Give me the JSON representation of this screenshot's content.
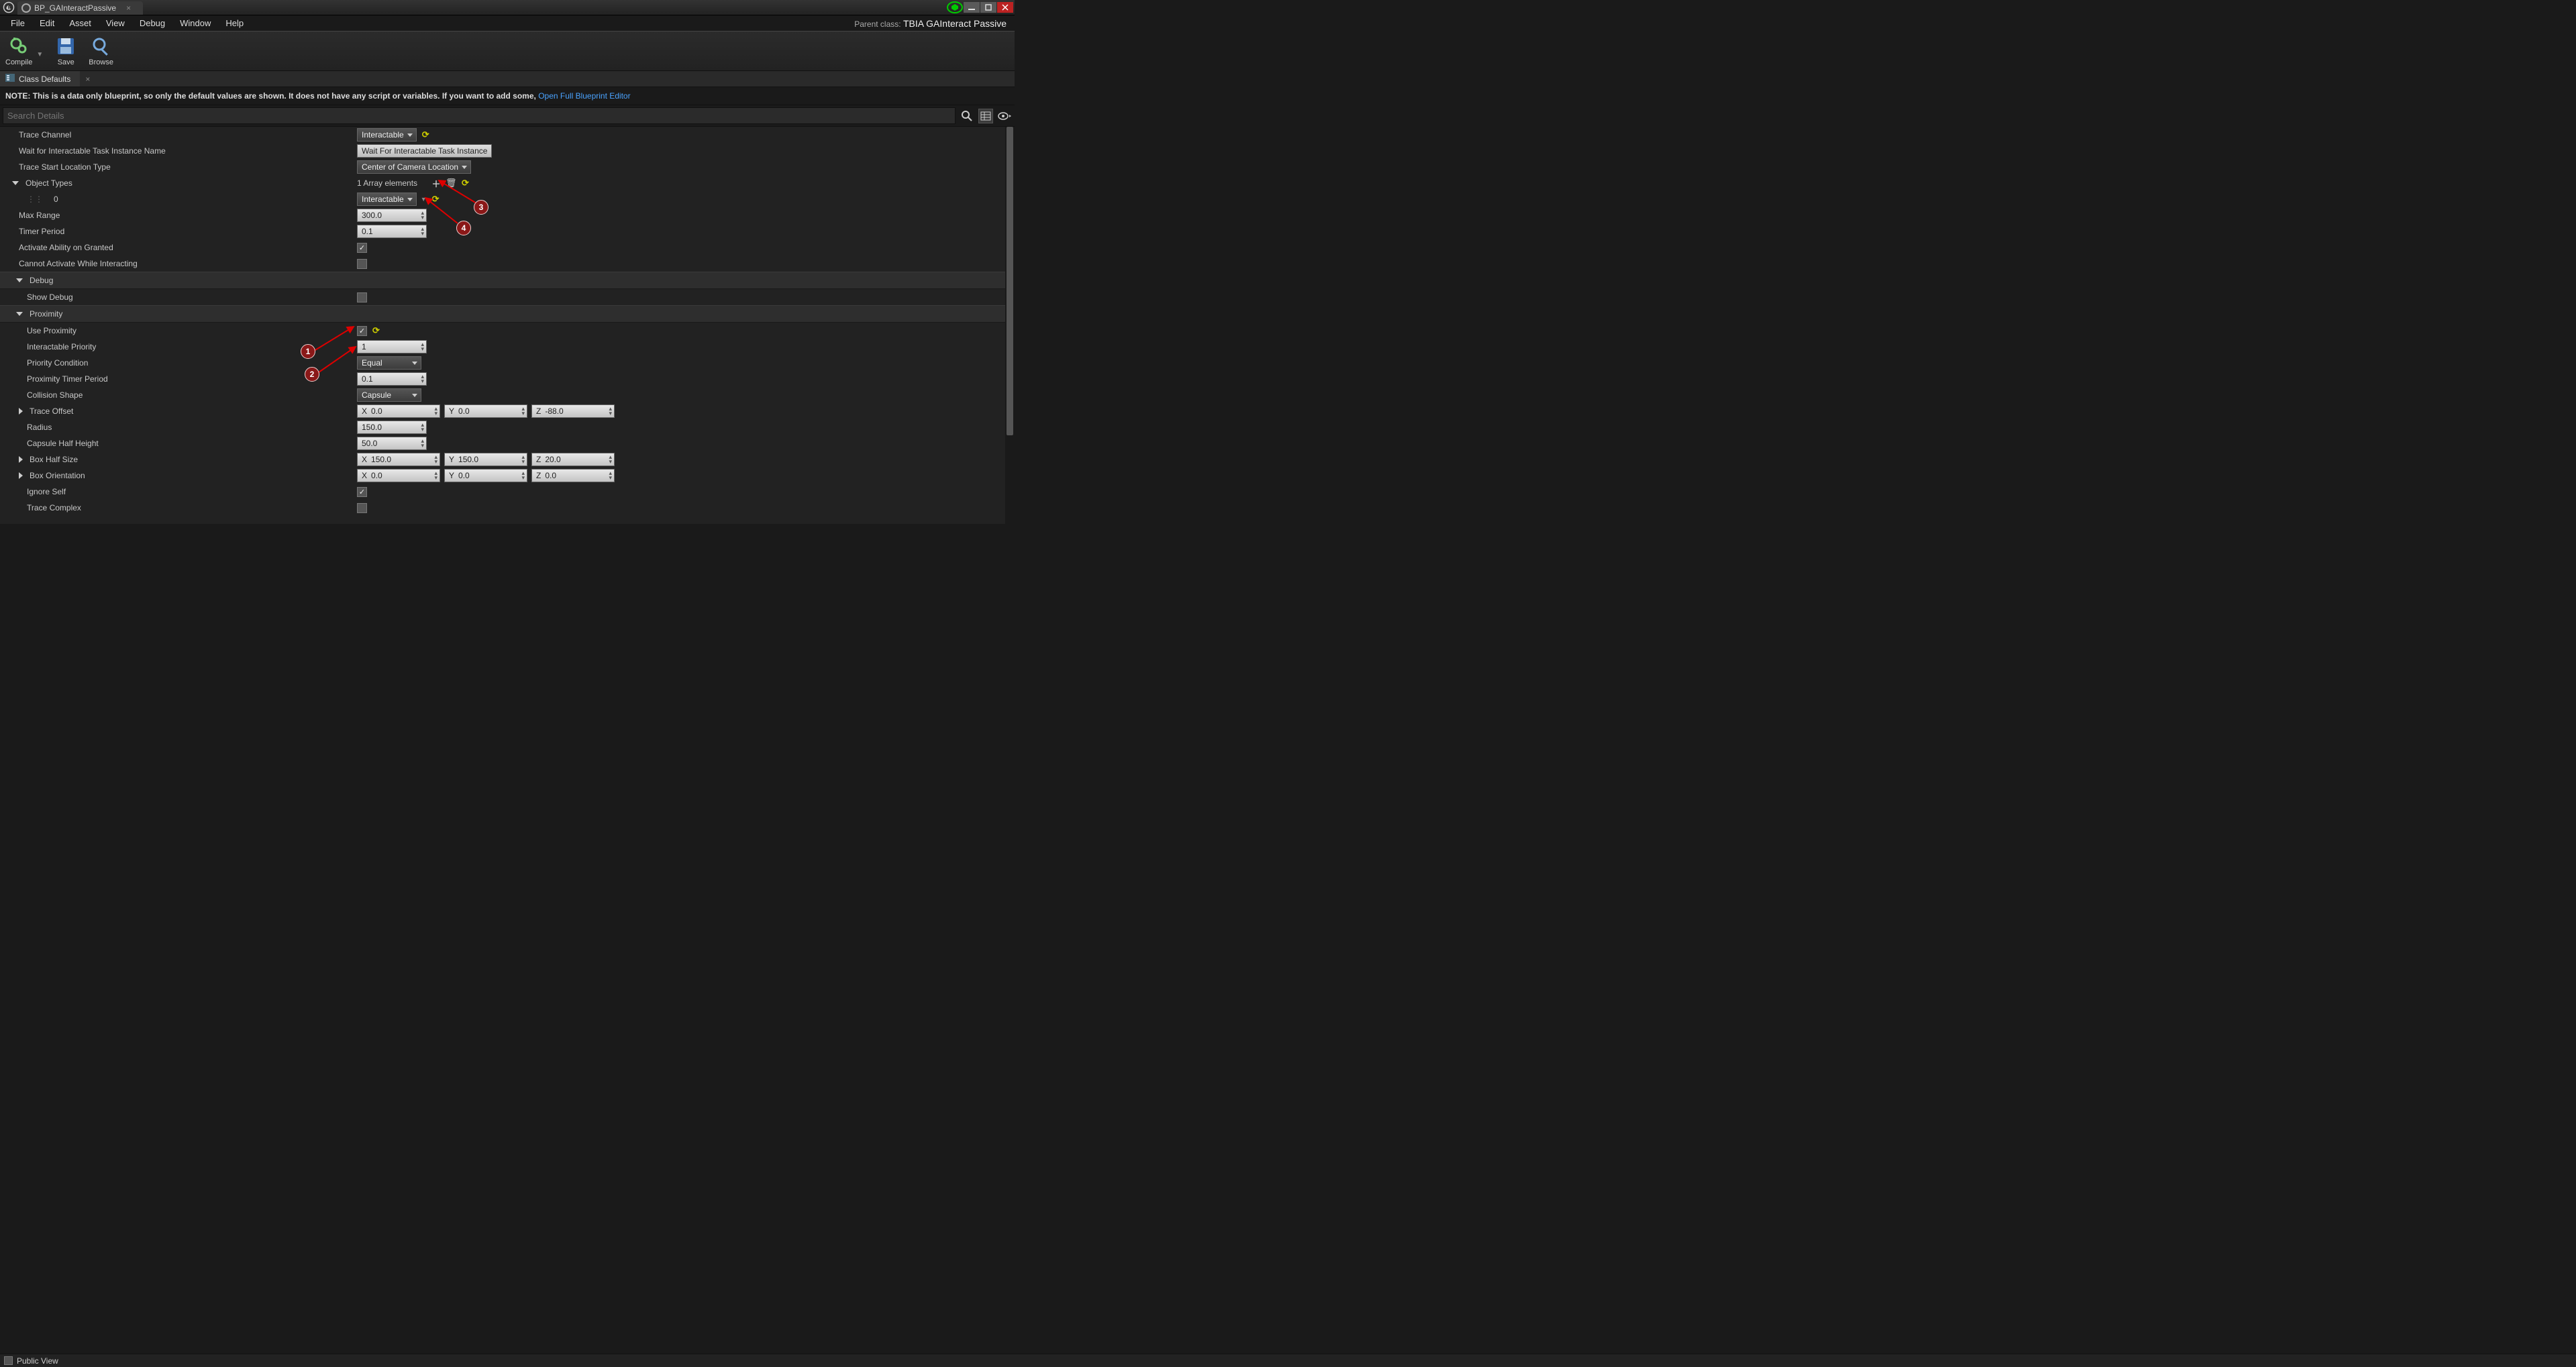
{
  "window": {
    "tab_title": "BP_GAInteractPassive",
    "parent_class_label": "Parent class:",
    "parent_class_value": "TBIA GAInteract Passive"
  },
  "menu": {
    "file": "File",
    "edit": "Edit",
    "asset": "Asset",
    "view": "View",
    "debug": "Debug",
    "window": "Window",
    "help": "Help"
  },
  "toolbar": {
    "compile": "Compile",
    "save": "Save",
    "browse": "Browse"
  },
  "sub_tab": {
    "title": "Class Defaults"
  },
  "notebar": {
    "prefix": "NOTE:",
    "text": "This is a data only blueprint, so only the default values are shown.  It does not have any script or variables.  If you want to add some,",
    "link": "Open Full Blueprint Editor"
  },
  "search": {
    "placeholder": "Search Details"
  },
  "labels": {
    "trace_channel": "Trace Channel",
    "wait_task": "Wait for Interactable Task Instance Name",
    "trace_start": "Trace Start Location Type",
    "object_types": "Object Types",
    "idx0": "0",
    "max_range": "Max Range",
    "timer_period": "Timer Period",
    "activate_on_granted": "Activate Ability on Granted",
    "cannot_activate": "Cannot Activate While Interacting",
    "debug": "Debug",
    "show_debug": "Show Debug",
    "proximity": "Proximity",
    "use_proximity": "Use Proximity",
    "interactable_priority": "Interactable Priority",
    "priority_condition": "Priority Condition",
    "proximity_timer": "Proximity Timer Period",
    "collision_shape": "Collision Shape",
    "trace_offset": "Trace Offset",
    "radius": "Radius",
    "capsule_half": "Capsule Half Height",
    "box_half": "Box Half Size",
    "box_orient": "Box Orientation",
    "ignore_self": "Ignore Self",
    "trace_complex": "Trace Complex"
  },
  "values": {
    "trace_channel": "Interactable",
    "wait_task": "Wait For Interactable Task Instance",
    "trace_start": "Center of Camera Location",
    "array_elements": "1 Array elements",
    "obj_type_0": "Interactable",
    "max_range": "300.0",
    "timer_period": "0.1",
    "interactable_priority": "1",
    "priority_condition": "Equal",
    "proximity_timer": "0.1",
    "collision_shape": "Capsule",
    "trace_offset": {
      "x": "0.0",
      "y": "0.0",
      "z": "-88.0"
    },
    "radius": "150.0",
    "capsule_half": "50.0",
    "box_half": {
      "x": "150.0",
      "y": "150.0",
      "z": "20.0"
    },
    "box_orient": {
      "x": "0.0",
      "y": "0.0",
      "z": "0.0"
    }
  },
  "checks": {
    "activate_on_granted": true,
    "cannot_activate": false,
    "show_debug": false,
    "use_proximity": true,
    "ignore_self": true,
    "trace_complex": false
  },
  "annotations": {
    "a1": "1",
    "a2": "2",
    "a3": "3",
    "a4": "4"
  },
  "footer": {
    "public_view": "Public View"
  }
}
